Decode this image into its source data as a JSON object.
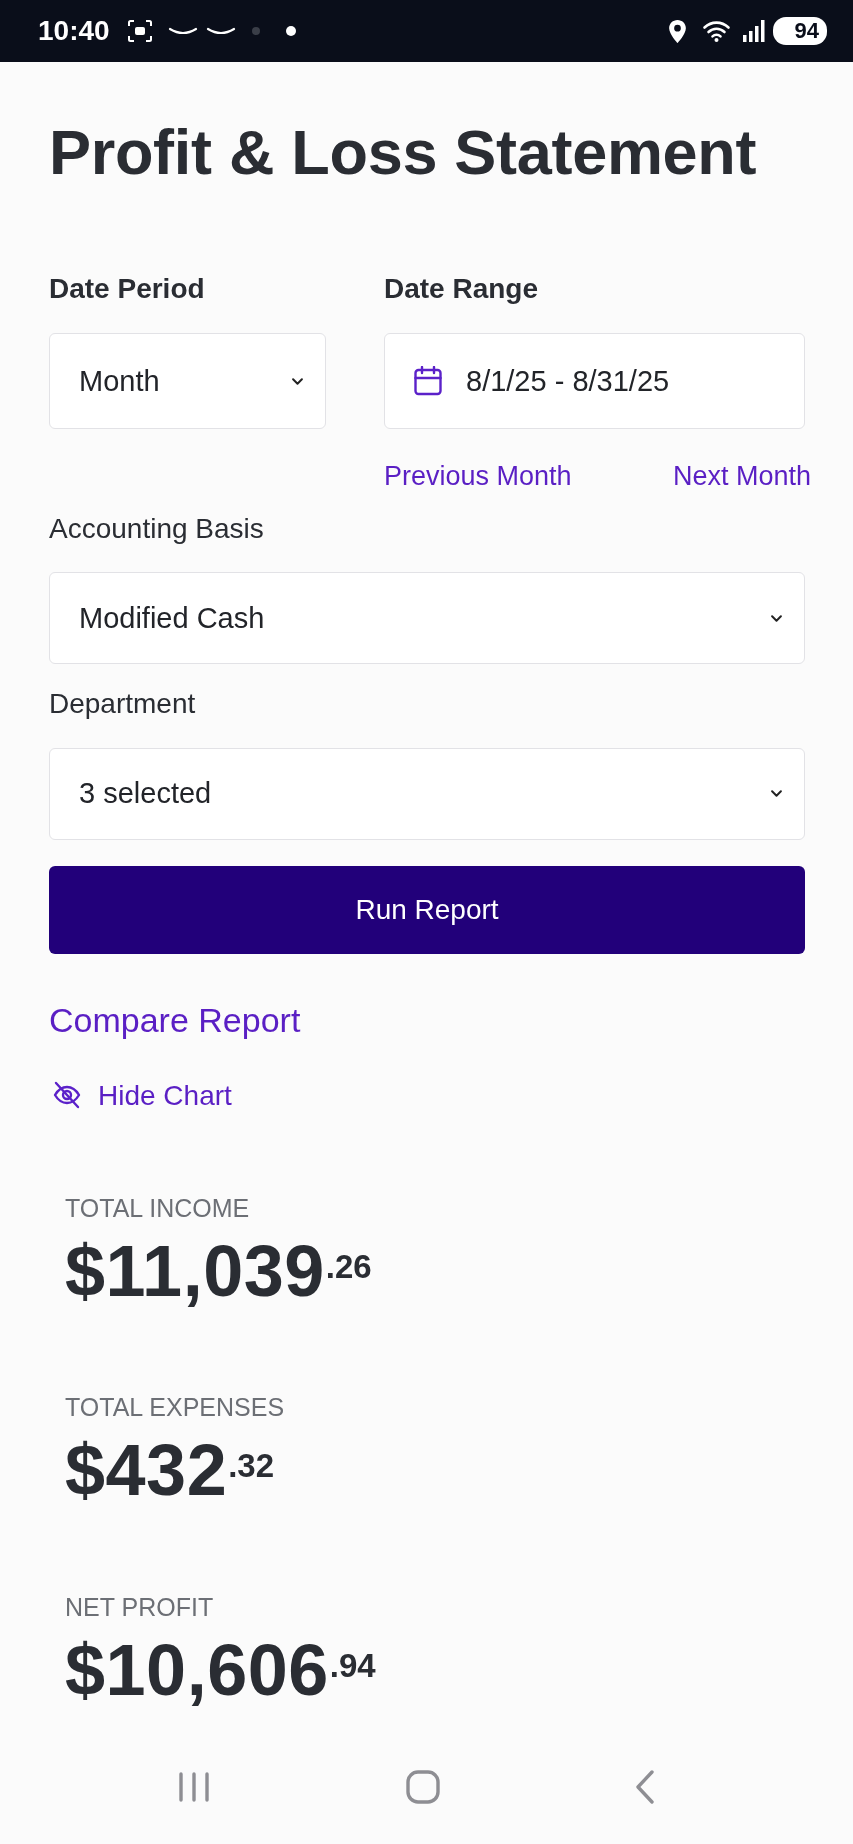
{
  "status_bar": {
    "time": "10:40",
    "battery": "94"
  },
  "title": "Profit & Loss Statement",
  "filters": {
    "date_period": {
      "label": "Date Period",
      "value": "Month"
    },
    "date_range": {
      "label": "Date Range",
      "value": "8/1/25 - 8/31/25",
      "links": [
        "Previous Month",
        "Next Month"
      ]
    },
    "accounting_basis": {
      "label": "Accounting Basis",
      "value": "Modified Cash"
    },
    "department": {
      "label": "Department",
      "value": "3 selected"
    }
  },
  "run_button": "Run Report",
  "compare_link": "Compare Report",
  "chart_toggle": "Hide Chart",
  "totals": [
    {
      "label": "TOTAL INCOME",
      "amount": "$11,039$^{.26}$"
    },
    {
      "label": "TOTAL EXPENSES",
      "amount": "$432$^{.32}$"
    },
    {
      "label": "NET PROFIT",
      "amount": "$10,606$^{.94}$"
    }
  ]
}
